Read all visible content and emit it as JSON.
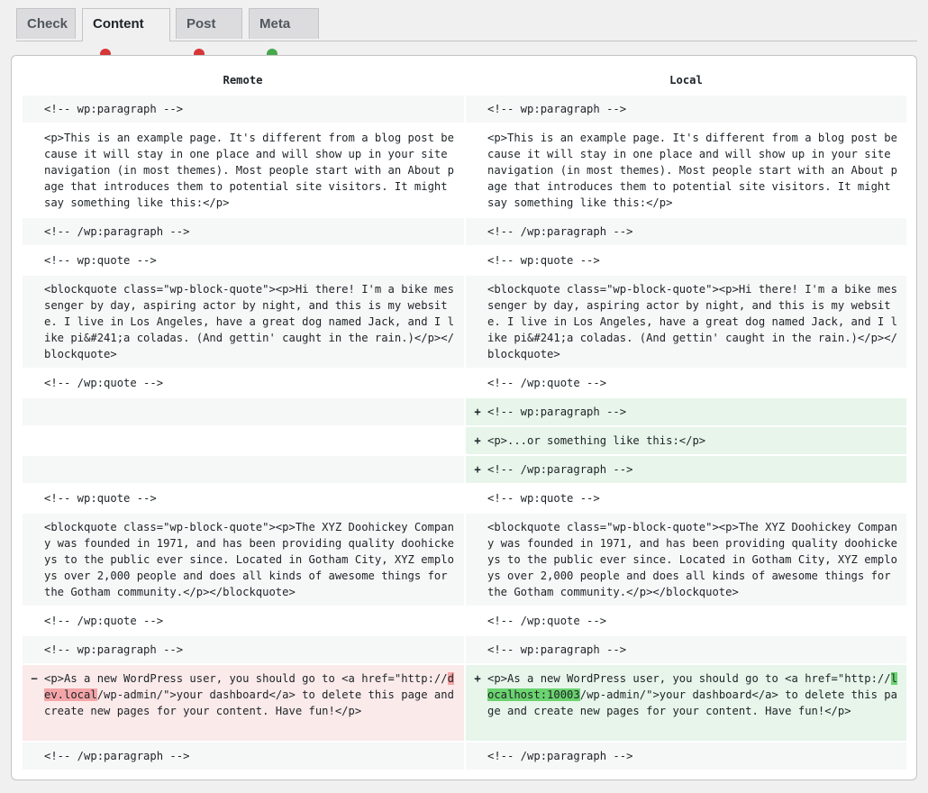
{
  "tabs": [
    {
      "label": "Check",
      "dot": null,
      "active": false
    },
    {
      "label": "Content",
      "dot": "#d63638",
      "active": true
    },
    {
      "label": "Post",
      "dot": "#d63638",
      "active": false
    },
    {
      "label": "Meta",
      "dot": "#46a84b",
      "active": false
    }
  ],
  "columns": {
    "remote": "Remote",
    "local": "Local"
  },
  "colors": {
    "added_bg": "#e7f5ea",
    "removed_bg": "#fbeaea",
    "added_highlight": "#6bd36f",
    "removed_highlight": "#f4a5a8"
  },
  "rows": [
    {
      "type": "same",
      "remote": "<!-- wp:paragraph -->",
      "local": "<!-- wp:paragraph -->"
    },
    {
      "type": "same",
      "remote": "<p>This is an example page. It's different from a blog post because it will stay in one place and will show up in your site navigation (in most themes). Most people start with an About page that introduces them to potential site visitors. It might say something like this:</p>",
      "local": "<p>This is an example page. It's different from a blog post because it will stay in one place and will show up in your site navigation (in most themes). Most people start with an About page that introduces them to potential site visitors. It might say something like this:</p>"
    },
    {
      "type": "same",
      "remote": "<!-- /wp:paragraph -->",
      "local": "<!-- /wp:paragraph -->"
    },
    {
      "type": "same",
      "remote": "<!-- wp:quote -->",
      "local": "<!-- wp:quote -->"
    },
    {
      "type": "same",
      "remote": "<blockquote class=\"wp-block-quote\"><p>Hi there! I'm a bike messenger by day, aspiring actor by night, and this is my website. I live in Los Angeles, have a great dog named Jack, and I like pi&#241;a coladas. (And gettin' caught in the rain.)</p></blockquote>",
      "local": "<blockquote class=\"wp-block-quote\"><p>Hi there! I'm a bike messenger by day, aspiring actor by night, and this is my website. I live in Los Angeles, have a great dog named Jack, and I like pi&#241;a coladas. (And gettin' caught in the rain.)</p></blockquote>"
    },
    {
      "type": "same",
      "remote": "<!-- /wp:quote -->",
      "local": "<!-- /wp:quote -->"
    },
    {
      "type": "added",
      "remote": "",
      "local": "<!-- wp:paragraph -->",
      "local_mark": "+"
    },
    {
      "type": "added",
      "remote": "",
      "local": "<p>...or something like this:</p>",
      "local_mark": "+"
    },
    {
      "type": "added",
      "remote": "",
      "local": "<!-- /wp:paragraph -->",
      "local_mark": "+"
    },
    {
      "type": "same",
      "remote": "<!-- wp:quote -->",
      "local": "<!-- wp:quote -->"
    },
    {
      "type": "same",
      "remote": "<blockquote class=\"wp-block-quote\"><p>The XYZ Doohickey Company was founded in 1971, and has been providing quality doohickeys to the public ever since. Located in Gotham City, XYZ employs over 2,000 people and does all kinds of awesome things for the Gotham community.</p></blockquote>",
      "local": "<blockquote class=\"wp-block-quote\"><p>The XYZ Doohickey Company was founded in 1971, and has been providing quality doohickeys to the public ever since. Located in Gotham City, XYZ employs over 2,000 people and does all kinds of awesome things for the Gotham community.</p></blockquote>"
    },
    {
      "type": "same",
      "remote": "<!-- /wp:quote -->",
      "local": "<!-- /wp:quote -->"
    },
    {
      "type": "same",
      "remote": "<!-- wp:paragraph -->",
      "local": "<!-- wp:paragraph -->"
    },
    {
      "type": "changed",
      "remote_mark": "−",
      "local_mark": "+",
      "remote_parts": [
        "<p>As a new WordPress user, you should go to <a href=\"http://",
        "dev.local",
        "/wp-admin/\">your dashboard</a> to delete this page and create new pages for your content. Have fun!</p>"
      ],
      "local_parts": [
        "<p>As a new WordPress user, you should go to <a href=\"http://",
        "localhost:10003",
        "/wp-admin/\">your dashboard</a> to delete this page and create new pages for your content. Have fun!</p>"
      ]
    },
    {
      "type": "same",
      "remote": "<!-- /wp:paragraph -->",
      "local": "<!-- /wp:paragraph -->"
    }
  ]
}
